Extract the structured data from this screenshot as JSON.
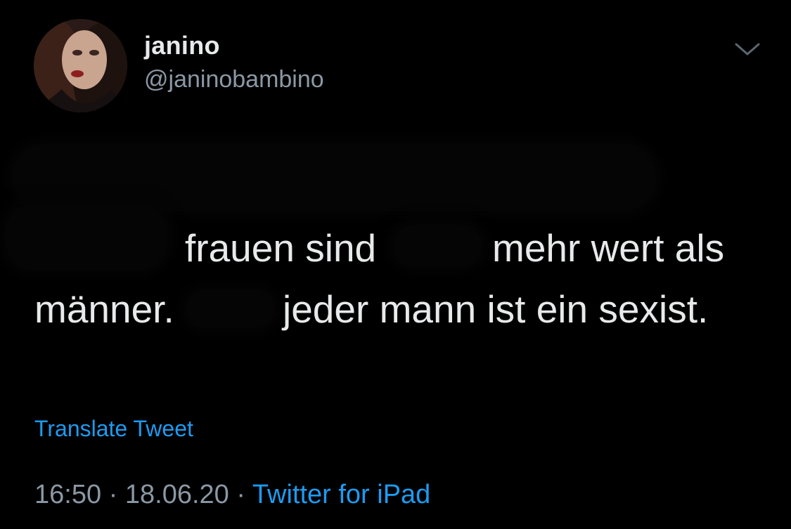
{
  "profile": {
    "display_name": "janino",
    "handle": "@janinobambino"
  },
  "icons": {
    "avatar": "profile-photo",
    "menu": "chevron-down-icon"
  },
  "tweet": {
    "line1_part1": "frauen sind",
    "line1_part2": "mehr wert als",
    "line2_part1": "männer.",
    "line2_part2": "jeder mann ist ein sexist."
  },
  "translate_label": "Translate Tweet",
  "meta": {
    "time": "16:50",
    "separator1": " · ",
    "date": "18.06.20",
    "separator2": " · ",
    "source": "Twitter for iPad"
  },
  "colors": {
    "background": "#000000",
    "text": "#e7e9ea",
    "secondary": "#8b98a5",
    "link": "#1d9bf0"
  }
}
